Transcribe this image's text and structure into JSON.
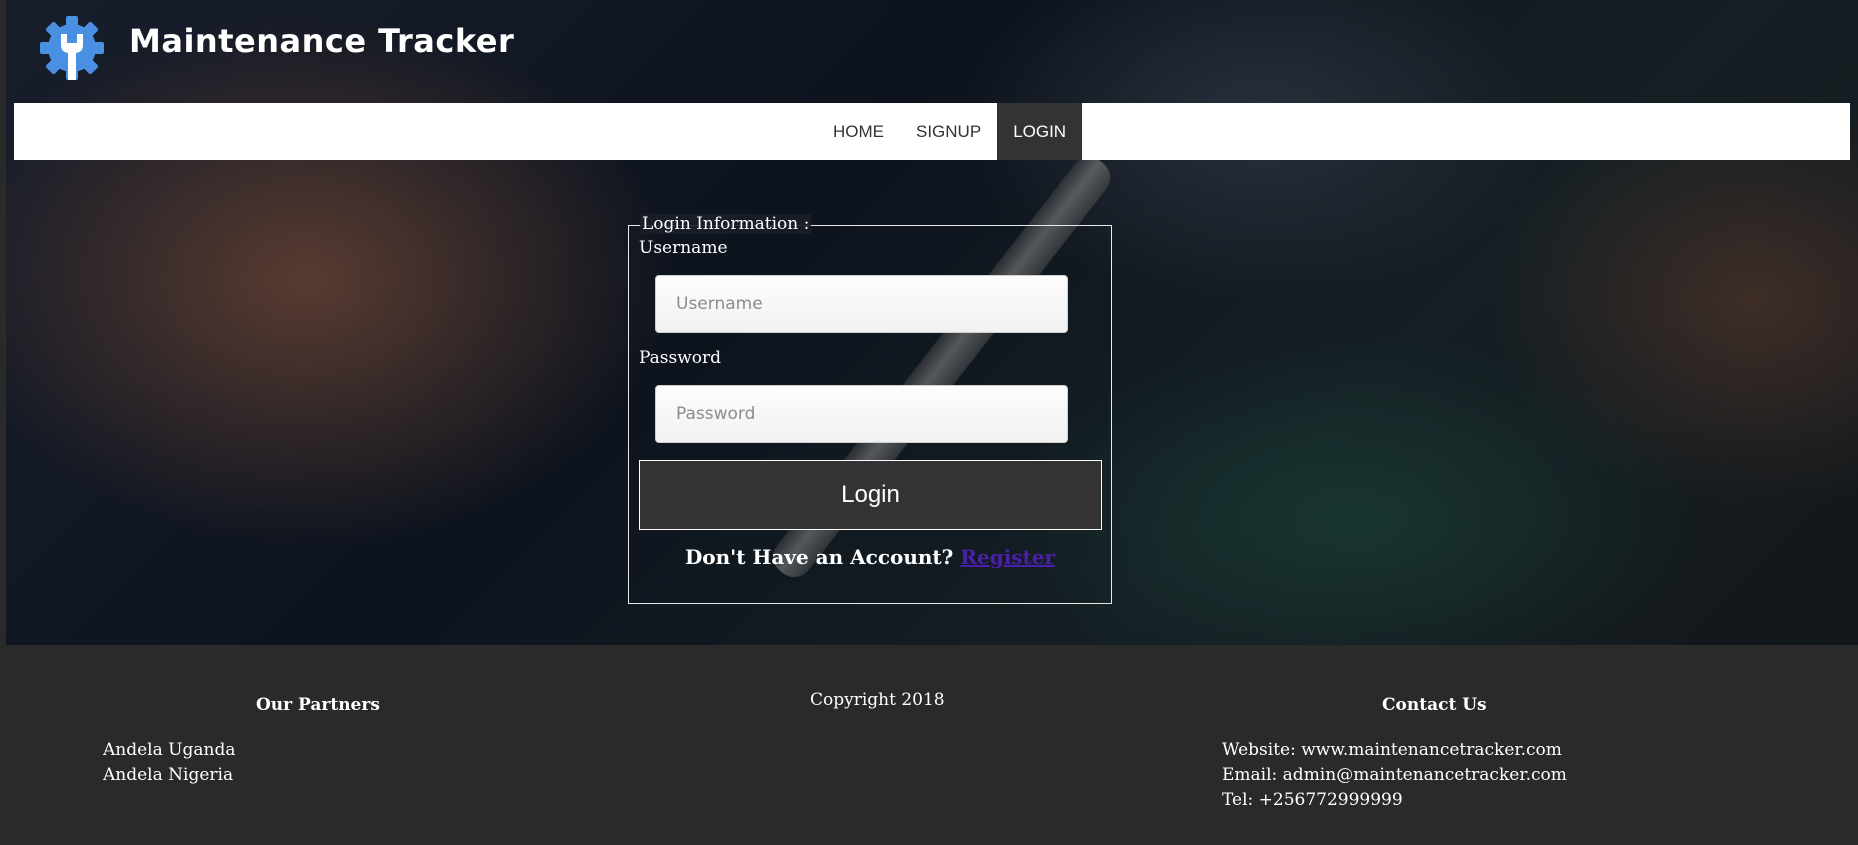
{
  "brand": {
    "title": "Maintenance Tracker",
    "logo_icon": "gear-wrench-icon",
    "logo_color": "#4a90e2"
  },
  "nav": {
    "items": [
      {
        "label": "HOME"
      },
      {
        "label": "SIGNUP"
      },
      {
        "label": "LOGIN",
        "active": true
      }
    ],
    "active_bg": "#333333"
  },
  "login": {
    "legend": "Login Information :",
    "username_label": "Username",
    "username_placeholder": "Username",
    "password_label": "Password",
    "password_placeholder": "Password",
    "submit_label": "Login",
    "register_prompt": "Don't Have an Account?",
    "register_link": "Register"
  },
  "footer": {
    "partners_title": "Our Partners",
    "partners": [
      "Andela Uganda",
      "Andela Nigeria"
    ],
    "copyright": "Copyright 2018",
    "contact_title": "Contact Us",
    "contact": {
      "website": "Website: www.maintenancetracker.com",
      "email": "Email: admin@maintenancetracker.com",
      "tel": "Tel: +256772999999"
    },
    "background": "#2a2a2a"
  }
}
